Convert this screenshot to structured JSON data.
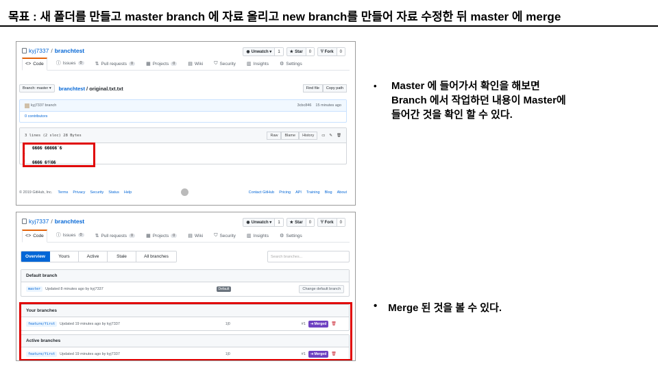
{
  "slide": {
    "title": "목표 : 새 폴더를 만들고 master branch 에 자료 올리고 new branch를 만들어 자료 수정한 뒤 master 에 merge",
    "bullet1_lines": [
      "Master 에 들어가서 확인을 해보면",
      "Branch 에서 작업하던 내용이 Master에",
      "들어간 것을 확인 할 수 있다."
    ],
    "bullet2": "Merge 된 것을 볼 수 있다."
  },
  "repo": {
    "owner": "kyj7337",
    "sep": "/",
    "name": "branchtest",
    "unwatch_label": "Unwatch ▾",
    "unwatch_count": "1",
    "star_label": "Star",
    "star_count": "0",
    "fork_label": "Fork",
    "fork_count": "0"
  },
  "tabs": [
    {
      "label": "Code",
      "icon": "<>"
    },
    {
      "label": "Issues",
      "count": "0"
    },
    {
      "label": "Pull requests",
      "count": "0"
    },
    {
      "label": "Projects",
      "count": "0"
    },
    {
      "label": "Wiki"
    },
    {
      "label": "Security"
    },
    {
      "label": "Insights"
    },
    {
      "label": "Settings"
    }
  ],
  "file_view": {
    "branch_btn": "Branch: master ▾",
    "repo_link": "branchtest",
    "path_sep": "/",
    "file_name": "original.txt.txt",
    "find_file": "Find file",
    "copy_path": "Copy path",
    "commit_author": "kyj7337",
    "commit_branch": "branch",
    "commit_sha": "3cbc846",
    "commit_time": "15 minutes ago",
    "contributors": "0 contributors",
    "file_info": "3 lines (2 sloc)    28 Bytes",
    "raw": "Raw",
    "blame": "Blame",
    "history": "History",
    "lines": [
      {
        "n": "1",
        "text": "���� �����˝�"
      },
      {
        "n": "2",
        "text": ""
      },
      {
        "n": "3",
        "text": "���� �쿼��"
      }
    ],
    "footer_copy": "© 2019 GitHub, Inc.",
    "footer_links": [
      "Terms",
      "Privacy",
      "Security",
      "Status",
      "Help"
    ],
    "footer_right": [
      "Contact GitHub",
      "Pricing",
      "API",
      "Training",
      "Blog",
      "About"
    ]
  },
  "branches_view": {
    "subtabs": [
      "Overview",
      "Yours",
      "Active",
      "Stale",
      "All branches"
    ],
    "search_placeholder": "Search branches...",
    "default_header": "Default branch",
    "default_name": "master",
    "default_updated": "Updated 8 minutes ago by kyj7337",
    "default_badge": "Default",
    "change_default": "Change default branch",
    "yours_header": "Your branches",
    "active_header": "Active branches",
    "branch_name": "feature/first",
    "branch_updated": "Updated 19 minutes ago by kyj7337",
    "branch_ratio": "1|0",
    "pr_number": "#1",
    "merged_label": "⇥ Merged"
  }
}
